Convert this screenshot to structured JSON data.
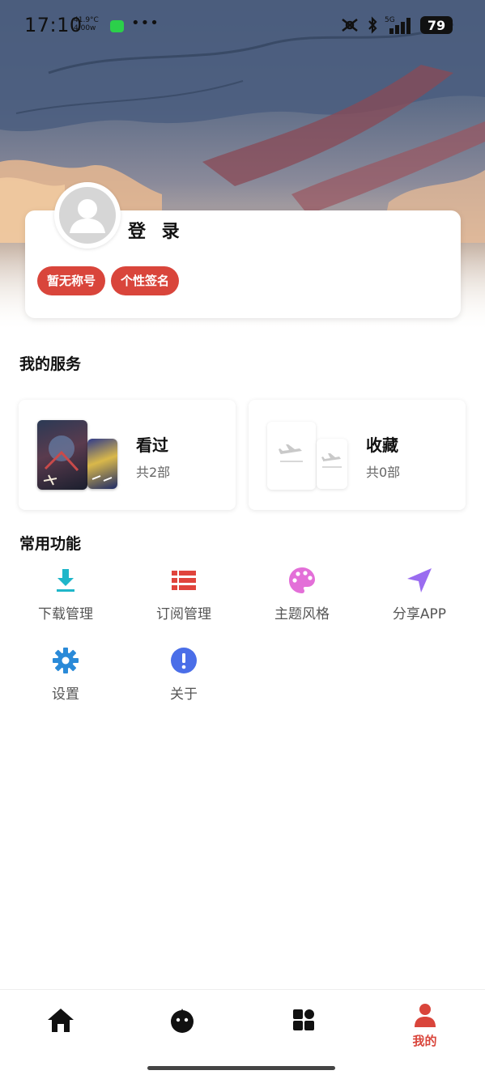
{
  "status_bar": {
    "time": "17:10",
    "temp": "41.9°C",
    "power": "4.00w",
    "network": "5G",
    "battery": "79"
  },
  "profile": {
    "login_label": "登 录",
    "tags": [
      "暂无称号",
      "个性签名"
    ]
  },
  "services": {
    "title": "我的服务",
    "history": {
      "label": "看过",
      "count": "共2部"
    },
    "favorites": {
      "label": "收藏",
      "count": "共0部"
    }
  },
  "functions": {
    "title": "常用功能",
    "items": [
      {
        "label": "下载管理",
        "icon": "download-icon",
        "color": "#1fb6c9"
      },
      {
        "label": "订阅管理",
        "icon": "list-icon",
        "color": "#e0443c"
      },
      {
        "label": "主题风格",
        "icon": "palette-icon",
        "color": "#e36fd8"
      },
      {
        "label": "分享APP",
        "icon": "send-icon",
        "color": "#9a6cf0"
      },
      {
        "label": "设置",
        "icon": "gear-icon",
        "color": "#2a8ad8"
      },
      {
        "label": "关于",
        "icon": "info-icon",
        "color": "#4a6ee8"
      }
    ]
  },
  "bottom_nav": {
    "items": [
      {
        "icon": "home-icon"
      },
      {
        "icon": "face-icon"
      },
      {
        "icon": "grid-icon"
      },
      {
        "icon": "person-icon",
        "label": "我的",
        "active": true
      }
    ],
    "active_color": "#d9453b"
  }
}
